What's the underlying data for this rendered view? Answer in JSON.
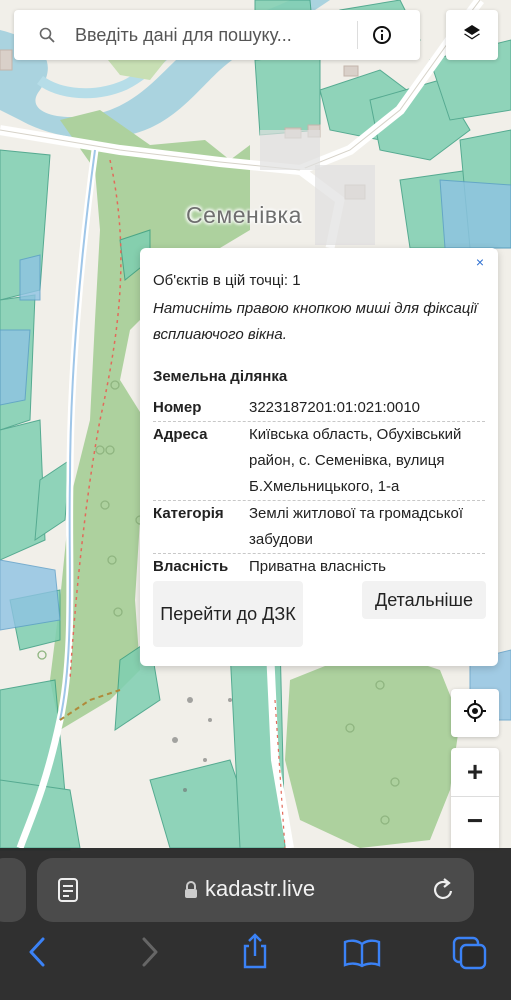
{
  "map": {
    "place_label": "Семенівка"
  },
  "search": {
    "placeholder": "Введіть дані для пошуку...",
    "search_icon": "search-icon",
    "info_icon": "info-icon"
  },
  "layers": {
    "icon": "layers-icon"
  },
  "popup": {
    "close": "×",
    "count_text": "Об'єктів в цій точці: 1",
    "hint": "Натисніть правою кнопкою миші для фіксації всплиаючого вікна.",
    "section_title": "Земельна ділянка",
    "rows": [
      {
        "key": "Номер",
        "value": "3223187201:01:021:0010"
      },
      {
        "key": "Адреса",
        "value": "Київська область, Обухівський район, с. Семенівка, вулиця Б.Хмельницького, 1-а"
      },
      {
        "key": "Категорія",
        "value": "Землі житлової та громадської забудови"
      },
      {
        "key": "Власність",
        "value": "Приватна власність"
      }
    ],
    "btn_dzk": "Перейти до ДЗК",
    "btn_details": "Детальніше"
  },
  "map_controls": {
    "locate_icon": "locate-icon",
    "zoom_in": "+",
    "zoom_out": "−"
  },
  "browser": {
    "url": "kadastr.live",
    "colors": {
      "bar": "#2a2a2a",
      "pill": "#4b4b4b",
      "accent": "#3b82f6"
    }
  }
}
